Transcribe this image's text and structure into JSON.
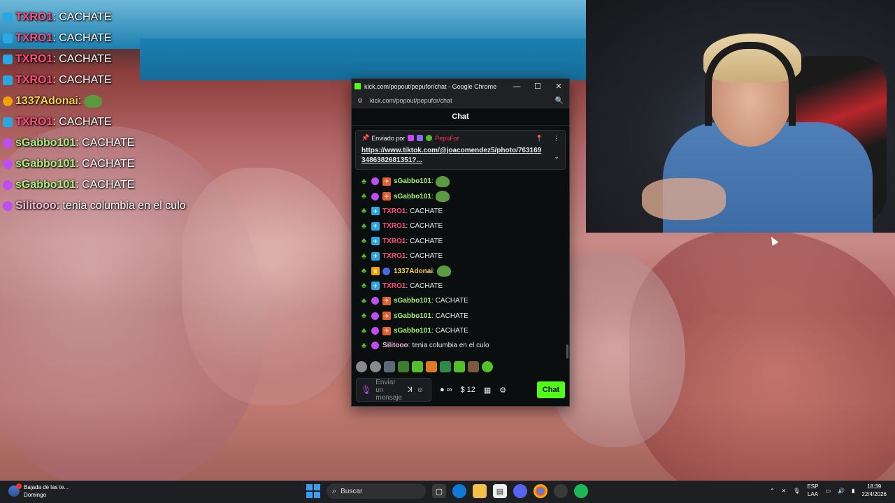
{
  "overlay": {
    "messages": [
      {
        "user": "TXRO1",
        "text": ": CACHATE",
        "color": "#ff4d7a"
      },
      {
        "user": "TXRO1",
        "text": ": CACHATE",
        "color": "#ff4d7a"
      },
      {
        "user": "TXRO1",
        "text": ": CACHATE",
        "color": "#ff4d7a"
      },
      {
        "user": "TXRO1",
        "text": ": CACHATE",
        "color": "#ff4d7a"
      },
      {
        "user": "1337Adonai",
        "text": ":",
        "color": "#f7d154",
        "emote": true
      },
      {
        "user": "TXRO1",
        "text": ": CACHATE",
        "color": "#ff4d7a"
      },
      {
        "user": "sGabbo101",
        "text": ": CACHATE",
        "color": "#a7f07c"
      },
      {
        "user": "sGabbo101",
        "text": ": CACHATE",
        "color": "#a7f07c"
      },
      {
        "user": "sGabbo101",
        "text": ": CACHATE",
        "color": "#a7f07c"
      },
      {
        "user": "Silitooo",
        "text": ": tenia columbia en el culo",
        "color": "#f2b8d8"
      }
    ]
  },
  "window": {
    "title": "kick.com/popout/pepufor/chat - Google Chrome",
    "url": "kick.com/popout/pepufor/chat",
    "minimize": "—",
    "maximize": "☐",
    "close": "✕"
  },
  "chat": {
    "header": "Chat",
    "pinned": {
      "label": "Enviado por",
      "user": "PepuFor",
      "link": "https://www.tiktok.com/@joacomendez5/photo/7631693486382681351?..."
    },
    "messages": [
      {
        "user": "sGabbo101",
        "sep": ":",
        "text": "",
        "color": "#a7f07c",
        "emote": true
      },
      {
        "user": "sGabbo101",
        "sep": ":",
        "text": "",
        "color": "#a7f07c",
        "emote": true
      },
      {
        "user": "TXRO1",
        "sep": ":",
        "text": "CACHATE",
        "color": "#ff4d7a"
      },
      {
        "user": "TXRO1",
        "sep": ":",
        "text": "CACHATE",
        "color": "#ff4d7a"
      },
      {
        "user": "TXRO1",
        "sep": ":",
        "text": "CACHATE",
        "color": "#ff4d7a"
      },
      {
        "user": "TXRO1",
        "sep": ":",
        "text": "CACHATE",
        "color": "#ff4d7a"
      },
      {
        "user": "1337Adonai",
        "sep": ":",
        "text": "",
        "color": "#f7d154",
        "emote": true
      },
      {
        "user": "TXRO1",
        "sep": ":",
        "text": "CACHATE",
        "color": "#ff4d7a"
      },
      {
        "user": "sGabbo101",
        "sep": ":",
        "text": "CACHATE",
        "color": "#a7f07c"
      },
      {
        "user": "sGabbo101",
        "sep": ":",
        "text": "CACHATE",
        "color": "#a7f07c"
      },
      {
        "user": "sGabbo101",
        "sep": ":",
        "text": "CACHATE",
        "color": "#a7f07c"
      },
      {
        "user": "Silitooo",
        "sep": ":",
        "text": "tenia columbia en el culo",
        "color": "#f2b8d8"
      }
    ],
    "input_placeholder_1": "Enviar",
    "input_placeholder_2": "un",
    "input_placeholder_3": "mensaje",
    "infinity_label": "∞",
    "points_label": "12",
    "send_label": "Chat"
  },
  "taskbar": {
    "news_title": "Bajada de las te...",
    "news_sub": "Domingo",
    "search_placeholder": "Buscar",
    "lang_1": "ESP",
    "lang_2": "LAA",
    "time": "18:39",
    "date": "22/4/2026"
  }
}
